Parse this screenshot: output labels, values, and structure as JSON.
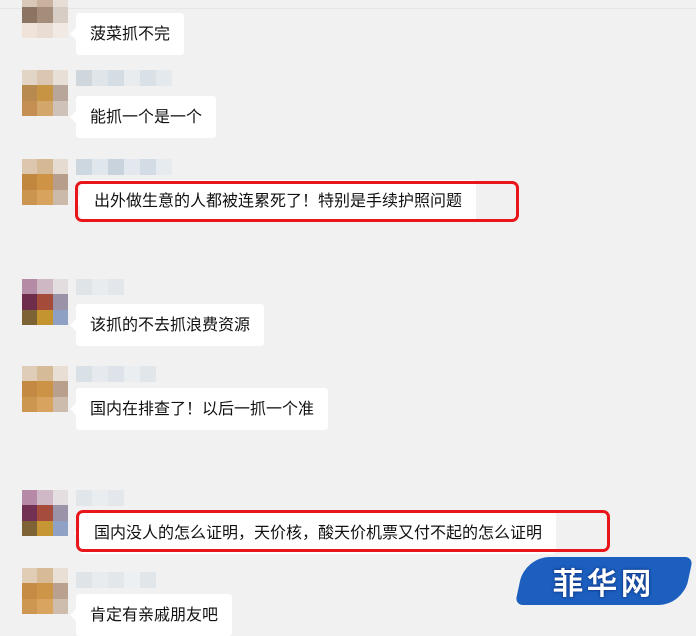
{
  "messages": [
    {
      "text": "菠菜抓不完",
      "highlighted": false
    },
    {
      "text": "能抓一个是一个",
      "highlighted": false
    },
    {
      "text": "出外做生意的人都被连累死了！特别是手续护照问题",
      "highlighted": true
    },
    {
      "text": "该抓的不去抓浪费资源",
      "highlighted": false
    },
    {
      "text": "国内在排查了！以后一抓一个准",
      "highlighted": false
    },
    {
      "text": "国内没人的怎么证明，天价核，酸天价机票又付不起的怎么证明",
      "highlighted": true
    },
    {
      "text": "肯定有亲戚朋友吧",
      "highlighted": false
    }
  ],
  "watermark": {
    "text": "菲华网"
  },
  "colors": {
    "background": "#f1f1f1",
    "bubble": "#ffffff",
    "highlight_border": "#e8161b",
    "watermark_badge": "#1c5fbf"
  }
}
